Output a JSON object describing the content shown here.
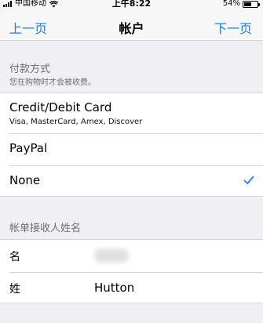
{
  "status_bar": {
    "carrier": "中国移动",
    "time": "上午8:22",
    "battery": "54%",
    "battery_level": 0.54
  },
  "nav": {
    "prev_label": "上一页",
    "title": "帐户",
    "next_label": "下一页"
  },
  "payment_section": {
    "header": "付款方式",
    "subheader": "您在购物时才会被收费。",
    "options": [
      {
        "label": "Credit/Debit Card",
        "sublabel": "Visa, MasterCard, Amex, Discover"
      },
      {
        "label": "PayPal"
      },
      {
        "label": "None",
        "selected": true
      }
    ]
  },
  "billing_section": {
    "header": "帐单接收人姓名",
    "first_name_label": "名",
    "first_name_value": "",
    "last_name_label": "姓",
    "last_name_value": "Hutton"
  },
  "colors": {
    "accent": "#1d7cf2",
    "background": "#efeff4"
  }
}
